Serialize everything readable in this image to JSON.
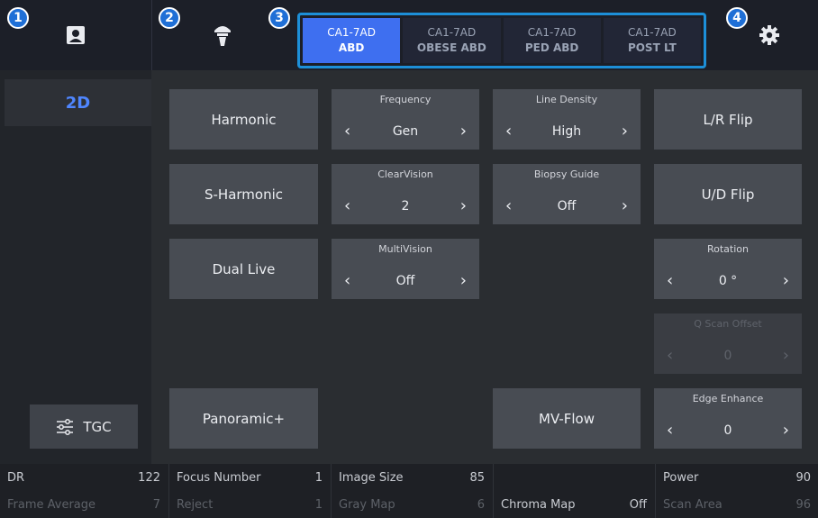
{
  "topbar": {
    "badges": [
      "1",
      "2",
      "3",
      "4"
    ],
    "icons": {
      "patient": "patient-id-icon",
      "probe": "probe-icon",
      "settings": "gear-icon"
    },
    "probe_tabs": [
      {
        "model": "CA1-7AD",
        "preset": "ABD",
        "active": true
      },
      {
        "model": "CA1-7AD",
        "preset": "OBESE ABD",
        "active": false
      },
      {
        "model": "CA1-7AD",
        "preset": "PED ABD",
        "active": false
      },
      {
        "model": "CA1-7AD",
        "preset": "POST LT",
        "active": false
      }
    ]
  },
  "left": {
    "mode_tab": "2D",
    "tgc_label": "TGC",
    "tgc_icon": "sliders-icon"
  },
  "buttons": {
    "harmonic": "Harmonic",
    "s_harmonic": "S-Harmonic",
    "dual_live": "Dual Live",
    "panoramic": "Panoramic+",
    "lr_flip": "L/R Flip",
    "ud_flip": "U/D Flip",
    "mv_flow": "MV-Flow"
  },
  "selectors": {
    "frequency": {
      "label": "Frequency",
      "value": "Gen"
    },
    "line_density": {
      "label": "Line Density",
      "value": "High"
    },
    "clearvision": {
      "label": "ClearVision",
      "value": "2"
    },
    "biopsy_guide": {
      "label": "Biopsy Guide",
      "value": "Off"
    },
    "multivision": {
      "label": "MultiVision",
      "value": "Off"
    },
    "rotation": {
      "label": "Rotation",
      "value": "0 °"
    },
    "q_scan_offset": {
      "label": "Q Scan Offset",
      "value": "0",
      "disabled": true
    },
    "edge_enhance": {
      "label": "Edge Enhance",
      "value": "0"
    }
  },
  "arrows": {
    "left": "‹",
    "right": "›"
  },
  "footer": {
    "row1": [
      {
        "label": "DR",
        "value": "122"
      },
      {
        "label": "Focus Number",
        "value": "1"
      },
      {
        "label": "Image Size",
        "value": "85"
      },
      {
        "label": "",
        "value": ""
      },
      {
        "label": "Power",
        "value": "90"
      }
    ],
    "row2": [
      {
        "label": "Frame Average",
        "value": "7"
      },
      {
        "label": "Reject",
        "value": "1"
      },
      {
        "label": "Gray Map",
        "value": "6"
      },
      {
        "label": "Chroma Map",
        "value": "Off"
      },
      {
        "label": "Scan Area",
        "value": "96"
      }
    ]
  },
  "colors": {
    "accent": "#3e6ff0",
    "probe_border": "#1d8fd8",
    "mode_text": "#4f86ff",
    "badge": "#1f6fd6"
  }
}
